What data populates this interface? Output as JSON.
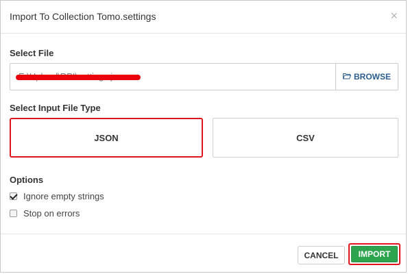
{
  "dialog": {
    "title": "Import To Collection Tomo.settings",
    "close_glyph": "×"
  },
  "select_file": {
    "label": "Select File",
    "value": "E:\\Upload\\RPI\\settings.json",
    "browse_icon": "folder-open-icon",
    "browse_label": "BROWSE"
  },
  "input_type": {
    "label": "Select Input File Type",
    "options": [
      {
        "label": "JSON",
        "selected": true
      },
      {
        "label": "CSV",
        "selected": false
      }
    ]
  },
  "options": {
    "label": "Options",
    "items": [
      {
        "label": "Ignore empty strings",
        "checked": true
      },
      {
        "label": "Stop on errors",
        "checked": false
      }
    ]
  },
  "footer": {
    "cancel_label": "CANCEL",
    "import_label": "IMPORT"
  },
  "colors": {
    "accent_green": "#2da44e",
    "highlight_red": "#e0141c",
    "link_blue": "#2a5d8f"
  }
}
